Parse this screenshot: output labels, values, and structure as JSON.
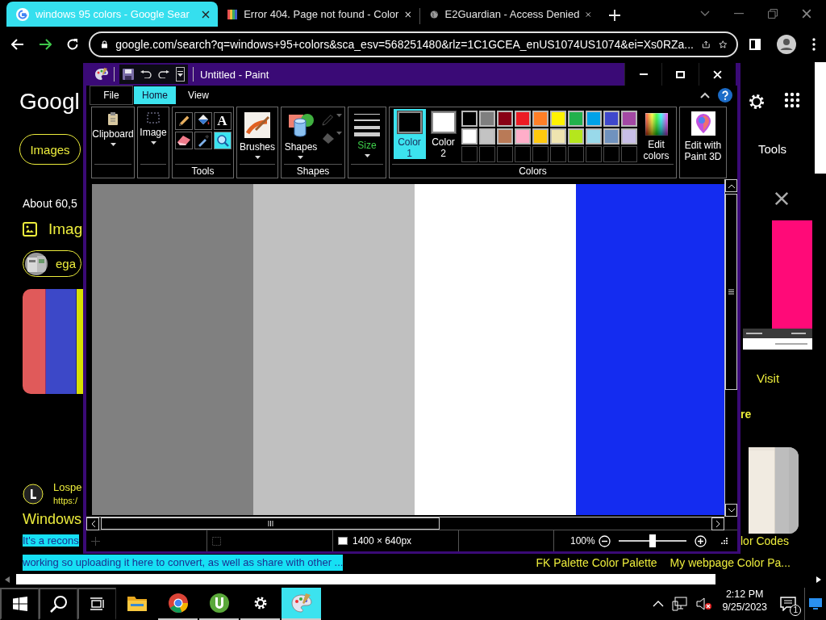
{
  "browser": {
    "tabs": [
      {
        "kind": "google",
        "title": "windows 95 colors - Google Sear",
        "selected": true
      },
      {
        "kind": "stripes",
        "title": "Error 404. Page not found - Color",
        "selected": false
      },
      {
        "kind": "globe",
        "title": "E2Guardian - Access Denied",
        "selected": false
      }
    ],
    "address": "google.com/search?q=windows+95+colors&sca_esv=568251480&rlz=1C1GCEA_enUS1074US1074&ei=Xs0RZa..."
  },
  "page": {
    "logo": "Googl",
    "images_chip": "Images",
    "result_count": "About 60,5",
    "images_heading": "Imag",
    "filter_chip": "ega",
    "source_name": "Lospe",
    "source_url": "https:/",
    "result_title": "Windows",
    "snippet": [
      "It's a recons",
      "working so uploading it here to convert, as well as share with other ..."
    ],
    "tools": "Tools",
    "visit": "Visit",
    "more": "re",
    "caption": "lor Codes",
    "links": [
      "FK Palette Color Palette",
      "My webpage Color Pa..."
    ]
  },
  "paint": {
    "title": "Untitled - Paint",
    "tabs": [
      {
        "label": "File",
        "selected": false
      },
      {
        "label": "Home",
        "selected": true
      },
      {
        "label": "View",
        "selected": false
      }
    ],
    "clipboard": "Clipboard",
    "image": "Image",
    "tools": {
      "label": "Tools",
      "items": [
        {
          "kind": "pencil",
          "selected": false
        },
        {
          "kind": "fill",
          "selected": false
        },
        {
          "kind": "text",
          "glyph": "A",
          "selected": false
        },
        {
          "kind": "eraser",
          "selected": false
        },
        {
          "kind": "picker",
          "selected": false
        },
        {
          "kind": "magnifier",
          "selected": true
        }
      ]
    },
    "brushes": "Brushes",
    "shapes": {
      "button": "Shapes",
      "label": "Shapes",
      "options": [
        {
          "kind": "outline",
          "disabled": true
        },
        {
          "kind": "fill",
          "disabled": true
        }
      ]
    },
    "size": "Size",
    "colors": {
      "label": "Colors",
      "current": [
        {
          "label": "Color 1",
          "color": "#000000",
          "selected": true
        },
        {
          "label": "Color 2",
          "color": "#ffffff",
          "selected": false
        }
      ],
      "palette": [
        {
          "kind": "color",
          "color": "#000000"
        },
        {
          "kind": "color",
          "color": "#7f7f7f"
        },
        {
          "kind": "color",
          "color": "#880015"
        },
        {
          "kind": "color",
          "color": "#ed1c24"
        },
        {
          "kind": "color",
          "color": "#ff7f27"
        },
        {
          "kind": "color",
          "color": "#fff200"
        },
        {
          "kind": "color",
          "color": "#22b14c"
        },
        {
          "kind": "color",
          "color": "#00a2e8"
        },
        {
          "kind": "color",
          "color": "#3f48cc"
        },
        {
          "kind": "color",
          "color": "#a349a4"
        },
        {
          "kind": "color",
          "color": "#ffffff"
        },
        {
          "kind": "color",
          "color": "#c3c3c3"
        },
        {
          "kind": "color",
          "color": "#b97a57"
        },
        {
          "kind": "color",
          "color": "#ffaec9"
        },
        {
          "kind": "color",
          "color": "#ffc90e"
        },
        {
          "kind": "color",
          "color": "#efe4b0"
        },
        {
          "kind": "color",
          "color": "#b5e61d"
        },
        {
          "kind": "color",
          "color": "#99d9ea"
        },
        {
          "kind": "color",
          "color": "#7092be"
        },
        {
          "kind": "color",
          "color": "#c8bfe7"
        },
        {
          "kind": "empty"
        },
        {
          "kind": "empty"
        },
        {
          "kind": "empty"
        },
        {
          "kind": "empty"
        },
        {
          "kind": "empty"
        },
        {
          "kind": "empty"
        },
        {
          "kind": "empty"
        },
        {
          "kind": "empty"
        },
        {
          "kind": "empty"
        },
        {
          "kind": "empty"
        }
      ],
      "edit": "Edit colors"
    },
    "paint3d": "Edit with Paint 3D",
    "canvas": {
      "stripes": [
        {
          "color": "#808080"
        },
        {
          "color": "#c0c0c0"
        },
        {
          "color": "#ffffff"
        },
        {
          "color": "#142cf0"
        }
      ]
    },
    "status": {
      "size": "1400 × 640px",
      "zoom": "100%",
      "zoom_slider": {
        "level": 0.5
      }
    }
  },
  "taskbar": {
    "apps": [
      {
        "kind": "explorer",
        "running": false,
        "selected": false
      },
      {
        "kind": "chrome",
        "running": true,
        "selected": false
      },
      {
        "kind": "torrent",
        "running": true,
        "selected": false
      },
      {
        "kind": "settings",
        "running": true,
        "selected": false
      },
      {
        "kind": "paint",
        "running": true,
        "selected": true
      }
    ],
    "volume_muted": true,
    "time": "2:12 PM",
    "date": "9/25/2023",
    "notifications": "1"
  }
}
